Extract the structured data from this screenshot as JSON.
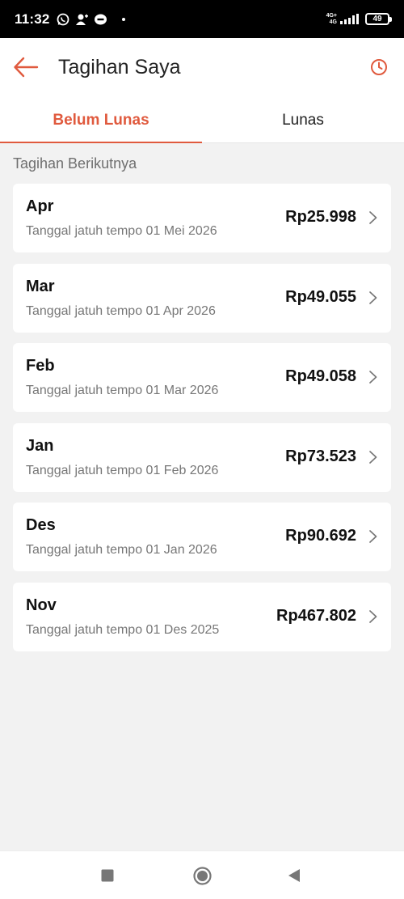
{
  "status_bar": {
    "time": "11:32",
    "network_type": "4G+",
    "network_sub": "4G",
    "battery": "49"
  },
  "header": {
    "title": "Tagihan Saya",
    "back_icon": "arrow-left-icon",
    "history_icon": "clock-icon",
    "accent_color": "#e05a3e"
  },
  "tabs": [
    {
      "label": "Belum Lunas",
      "active": true
    },
    {
      "label": "Lunas",
      "active": false
    }
  ],
  "section_label": "Tagihan Berikutnya",
  "bills": [
    {
      "month": "Apr",
      "due": "Tanggal jatuh tempo 01 Mei 2026",
      "amount": "Rp25.998"
    },
    {
      "month": "Mar",
      "due": "Tanggal jatuh tempo 01 Apr 2026",
      "amount": "Rp49.055"
    },
    {
      "month": "Feb",
      "due": "Tanggal jatuh tempo 01 Mar 2026",
      "amount": "Rp49.058"
    },
    {
      "month": "Jan",
      "due": "Tanggal jatuh tempo 01 Feb 2026",
      "amount": "Rp73.523"
    },
    {
      "month": "Des",
      "due": "Tanggal jatuh tempo 01 Jan 2026",
      "amount": "Rp90.692"
    },
    {
      "month": "Nov",
      "due": "Tanggal jatuh tempo 01 Des 2025",
      "amount": "Rp467.802"
    }
  ],
  "nav": {
    "recents_icon": "square-icon",
    "home_icon": "circle-icon",
    "back_icon": "triangle-back-icon"
  }
}
